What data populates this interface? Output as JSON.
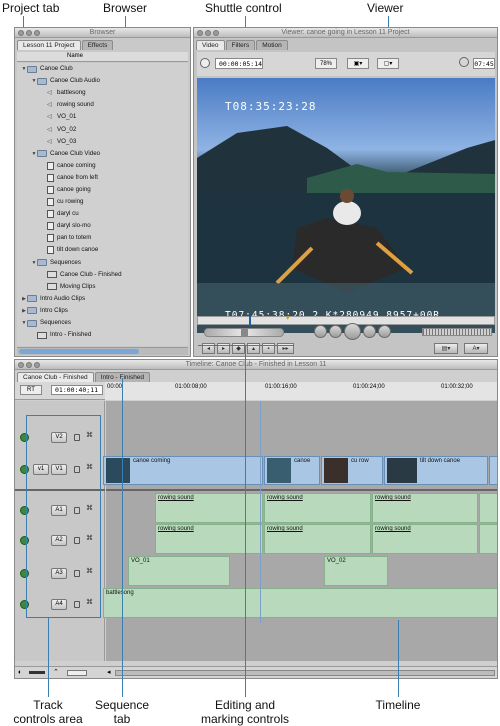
{
  "callouts": {
    "project_tab": "Project tab",
    "browser": "Browser",
    "shuttle_control": "Shuttle control",
    "viewer": "Viewer",
    "track_controls": "Track\ncontrols area",
    "sequence_tab": "Sequence\ntab",
    "editing_marking": "Editing and\nmarking controls",
    "timeline": "Timeline"
  },
  "browser": {
    "window_title": "Browser",
    "tabs": [
      "Lesson 11 Project",
      "Effects"
    ],
    "column_name": "Name",
    "items": [
      {
        "label": "Canoe Club",
        "indent": 0,
        "type": "folder",
        "open": true
      },
      {
        "label": "Canoe Club Audio",
        "indent": 1,
        "type": "folder",
        "open": true
      },
      {
        "label": "battlesong",
        "indent": 2,
        "type": "audio"
      },
      {
        "label": "rowing sound",
        "indent": 2,
        "type": "audio"
      },
      {
        "label": "VO_01",
        "indent": 2,
        "type": "audio"
      },
      {
        "label": "VO_02",
        "indent": 2,
        "type": "audio"
      },
      {
        "label": "VO_03",
        "indent": 2,
        "type": "audio"
      },
      {
        "label": "Canoe Club Video",
        "indent": 1,
        "type": "folder",
        "open": true
      },
      {
        "label": "canoe coming",
        "indent": 2,
        "type": "clip"
      },
      {
        "label": "canoe from left",
        "indent": 2,
        "type": "clip"
      },
      {
        "label": "canoe going",
        "indent": 2,
        "type": "clip"
      },
      {
        "label": "cu rowing",
        "indent": 2,
        "type": "clip"
      },
      {
        "label": "daryl cu",
        "indent": 2,
        "type": "clip"
      },
      {
        "label": "daryl slo-mo",
        "indent": 2,
        "type": "clip"
      },
      {
        "label": "pan to totem",
        "indent": 2,
        "type": "clip"
      },
      {
        "label": "tilt down canoe",
        "indent": 2,
        "type": "clip"
      },
      {
        "label": "Sequences",
        "indent": 1,
        "type": "folder",
        "open": true
      },
      {
        "label": "Canoe Club - Finished",
        "indent": 2,
        "type": "seq"
      },
      {
        "label": "Moving Clips",
        "indent": 2,
        "type": "seq"
      },
      {
        "label": "Intro Audio Clips",
        "indent": 0,
        "type": "folder",
        "open": false
      },
      {
        "label": "Intro Clips",
        "indent": 0,
        "type": "folder",
        "open": false
      },
      {
        "label": "Sequences",
        "indent": 0,
        "type": "folder",
        "open": true
      },
      {
        "label": "Intro - Finished",
        "indent": 1,
        "type": "seq"
      }
    ]
  },
  "viewer": {
    "window_title": "Viewer: canoe going in Lesson 11 Project",
    "tabs": [
      "Video",
      "Filters",
      "Motion"
    ],
    "duration": "00:00:05:14",
    "zoom": "78%",
    "current_tc": "07:45",
    "burn_top": "T08:35:23:28",
    "burn_bottom": "T07:45:38:20 2 K*280949 8957+00R"
  },
  "timeline": {
    "window_title": "Timeline: Canoe Club - Finished in Lesson 11",
    "tabs": [
      "Canoe Club - Finished",
      "Intro - Finished"
    ],
    "rt": "RT",
    "playhead_tc": "01:00:40;11",
    "ruler": [
      "00:00",
      "01:00:08;00",
      "01:00:16;00",
      "01:00:24;00",
      "01:00:32;00"
    ],
    "tracks": {
      "v2": "V2",
      "v1_src": "v1",
      "v1": "V1",
      "a1": "A1",
      "a2": "A2",
      "a3": "A3",
      "a4": "A4"
    },
    "video_clips": [
      "canoe coming",
      "canoe",
      "cu row",
      "tilt down canoe"
    ],
    "audio_rowing": "rowing sound",
    "vo1": "VO_01",
    "vo2": "VO_02",
    "music": "battlesong"
  }
}
